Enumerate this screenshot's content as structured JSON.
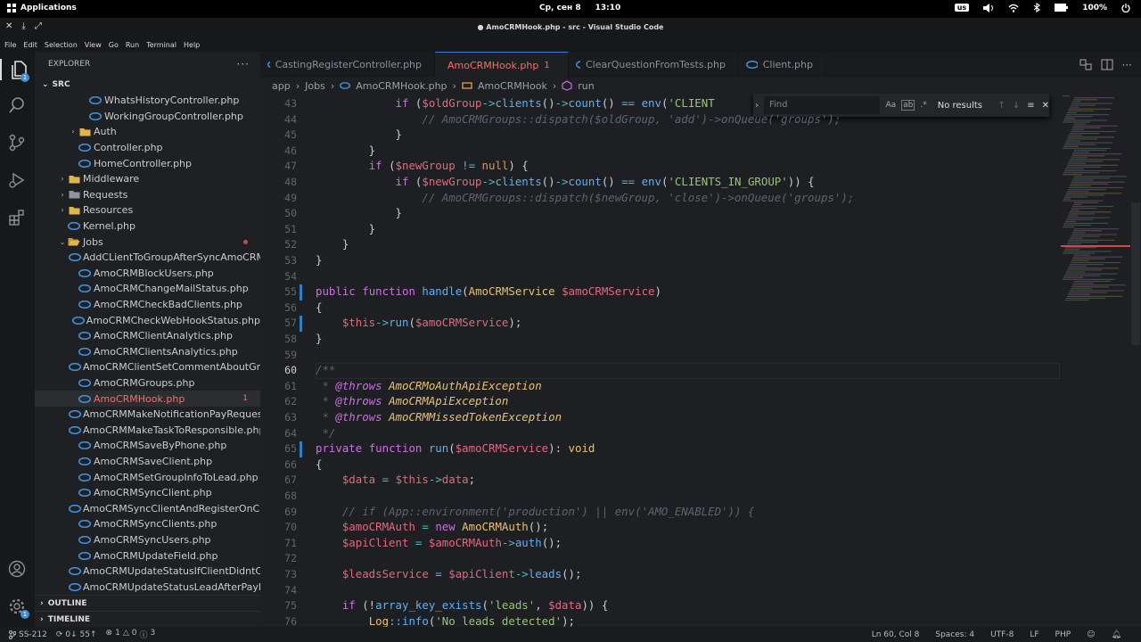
{
  "system_bar": {
    "apps_label": "Applications",
    "date": "Ср, сен  8",
    "time": "13:10",
    "keyboard_layout": "us",
    "battery": "100%"
  },
  "window": {
    "title": "● AmoCRMHook.php - src - Visual Studio Code"
  },
  "menu": [
    "File",
    "Edit",
    "Selection",
    "View",
    "Go",
    "Run",
    "Terminal",
    "Help"
  ],
  "activity_bar": {
    "explorer_badge": "1",
    "settings_badge": "1"
  },
  "sidebar": {
    "title": "EXPLORER",
    "section": "SRC",
    "rows": [
      {
        "label": "WhatsHistoryController.php",
        "indent": 3,
        "type": "php"
      },
      {
        "label": "WorkingGroupController.php",
        "indent": 3,
        "type": "php"
      },
      {
        "label": "Auth",
        "indent": 2,
        "type": "folder"
      },
      {
        "label": "Controller.php",
        "indent": 2,
        "type": "php"
      },
      {
        "label": "HomeController.php",
        "indent": 2,
        "type": "php"
      },
      {
        "label": "Middleware",
        "indent": 1,
        "type": "folder"
      },
      {
        "label": "Requests",
        "indent": 1,
        "type": "folder-grey"
      },
      {
        "label": "Resources",
        "indent": 1,
        "type": "folder"
      },
      {
        "label": "Kernel.php",
        "indent": 1,
        "type": "php"
      },
      {
        "label": "Jobs",
        "indent": 1,
        "type": "folder-open",
        "modified_dot": true
      },
      {
        "label": "AddCLientToGroupAfterSyncAmoCRM...",
        "indent": 2,
        "type": "php"
      },
      {
        "label": "AmoCRMBlockUsers.php",
        "indent": 2,
        "type": "php"
      },
      {
        "label": "AmoCRMChangeMailStatus.php",
        "indent": 2,
        "type": "php"
      },
      {
        "label": "AmoCRMCheckBadClients.php",
        "indent": 2,
        "type": "php"
      },
      {
        "label": "AmoCRMCheckWebHookStatus.php",
        "indent": 2,
        "type": "php"
      },
      {
        "label": "AmoCRMClientAnalytics.php",
        "indent": 2,
        "type": "php"
      },
      {
        "label": "AmoCRMClientsAnalytics.php",
        "indent": 2,
        "type": "php"
      },
      {
        "label": "AmoCRMClientSetCommentAboutGro...",
        "indent": 2,
        "type": "php"
      },
      {
        "label": "AmoCRMGroups.php",
        "indent": 2,
        "type": "php"
      },
      {
        "label": "AmoCRMHook.php",
        "indent": 2,
        "type": "php",
        "selected": true,
        "count": "1"
      },
      {
        "label": "AmoCRMMakeNotificationPayRequest....",
        "indent": 2,
        "type": "php"
      },
      {
        "label": "AmoCRMMakeTaskToResponsible.php",
        "indent": 2,
        "type": "php"
      },
      {
        "label": "AmoCRMSaveByPhone.php",
        "indent": 2,
        "type": "php"
      },
      {
        "label": "AmoCRMSaveClient.php",
        "indent": 2,
        "type": "php"
      },
      {
        "label": "AmoCRMSetGroupInfoToLead.php",
        "indent": 2,
        "type": "php"
      },
      {
        "label": "AmoCRMSyncClient.php",
        "indent": 2,
        "type": "php"
      },
      {
        "label": "AmoCRMSyncClientAndRegisterOnCas...",
        "indent": 2,
        "type": "php"
      },
      {
        "label": "AmoCRMSyncClients.php",
        "indent": 2,
        "type": "php"
      },
      {
        "label": "AmoCRMSyncUsers.php",
        "indent": 2,
        "type": "php"
      },
      {
        "label": "AmoCRMUpdateField.php",
        "indent": 2,
        "type": "php"
      },
      {
        "label": "AmoCRMUpdateStatusIfClientDidntCo...",
        "indent": 2,
        "type": "php"
      },
      {
        "label": "AmoCRMUpdateStatusLeadAfterPayRe...",
        "indent": 2,
        "type": "php"
      }
    ],
    "outline": "OUTLINE",
    "timeline": "TIMELINE"
  },
  "tabs": [
    {
      "label": "CastingRegisterController.php",
      "active": false
    },
    {
      "label": "AmoCRMHook.php",
      "active": true,
      "count": "1",
      "modified": true
    },
    {
      "label": "ClearQuestionFromTests.php",
      "active": false
    },
    {
      "label": "Client.php",
      "active": false
    }
  ],
  "breadcrumb": [
    "app",
    "Jobs",
    "AmoCRMHook.php",
    "AmoCRMHook",
    "run"
  ],
  "find_widget": {
    "placeholder": "Find",
    "opt_case": "Aa",
    "opt_word": "ab",
    "opt_regex": ".*",
    "result": "No results"
  },
  "editor": {
    "current_line": 60,
    "lines": [
      {
        "n": 43,
        "tokens": [
          [
            "pl",
            "            "
          ],
          [
            "kw",
            "if"
          ],
          [
            "pl",
            " ("
          ],
          [
            "var",
            "$oldGroup"
          ],
          [
            "op",
            "->"
          ],
          [
            "fn",
            "clients"
          ],
          [
            "pl",
            "()"
          ],
          [
            "op",
            "->"
          ],
          [
            "fn",
            "count"
          ],
          [
            "pl",
            "() "
          ],
          [
            "op",
            "=="
          ],
          [
            "pl",
            " "
          ],
          [
            "fn",
            "env"
          ],
          [
            "pl",
            "("
          ],
          [
            "str",
            "'CLIENT"
          ]
        ]
      },
      {
        "n": 44,
        "tokens": [
          [
            "cm",
            "                // AmoCRMGroups::dispatch($oldGroup, 'add')->onQueue('groups');"
          ]
        ]
      },
      {
        "n": 45,
        "tokens": [
          [
            "pl",
            "            }"
          ]
        ]
      },
      {
        "n": 46,
        "tokens": [
          [
            "pl",
            "        }"
          ]
        ]
      },
      {
        "n": 47,
        "tokens": [
          [
            "pl",
            "        "
          ],
          [
            "kw",
            "if"
          ],
          [
            "pl",
            " ("
          ],
          [
            "var",
            "$newGroup"
          ],
          [
            "pl",
            " "
          ],
          [
            "op",
            "!="
          ],
          [
            "pl",
            " "
          ],
          [
            "num",
            "null"
          ],
          [
            "pl",
            ") {"
          ]
        ]
      },
      {
        "n": 48,
        "tokens": [
          [
            "pl",
            "            "
          ],
          [
            "kw",
            "if"
          ],
          [
            "pl",
            " ("
          ],
          [
            "var",
            "$newGroup"
          ],
          [
            "op",
            "->"
          ],
          [
            "fn",
            "clients"
          ],
          [
            "pl",
            "()"
          ],
          [
            "op",
            "->"
          ],
          [
            "fn",
            "count"
          ],
          [
            "pl",
            "() "
          ],
          [
            "op",
            "=="
          ],
          [
            "pl",
            " "
          ],
          [
            "fn",
            "env"
          ],
          [
            "pl",
            "("
          ],
          [
            "str",
            "'CLIENTS_IN_GROUP'"
          ],
          [
            "pl",
            ")) {"
          ]
        ]
      },
      {
        "n": 49,
        "tokens": [
          [
            "cm",
            "                // AmoCRMGroups::dispatch($newGroup, 'close')->onQueue('groups');"
          ]
        ]
      },
      {
        "n": 50,
        "tokens": [
          [
            "pl",
            "            }"
          ]
        ]
      },
      {
        "n": 51,
        "tokens": [
          [
            "pl",
            "        }"
          ]
        ]
      },
      {
        "n": 52,
        "tokens": [
          [
            "pl",
            "    }"
          ]
        ]
      },
      {
        "n": 53,
        "tokens": [
          [
            "pl",
            "}"
          ]
        ]
      },
      {
        "n": 54,
        "tokens": [
          [
            "pl",
            ""
          ]
        ]
      },
      {
        "n": 55,
        "tokens": [
          [
            "kw",
            "public"
          ],
          [
            "pl",
            " "
          ],
          [
            "kw",
            "function"
          ],
          [
            "pl",
            " "
          ],
          [
            "fn",
            "handle"
          ],
          [
            "pl",
            "("
          ],
          [
            "cls",
            "AmoCRMService"
          ],
          [
            "pl",
            " "
          ],
          [
            "var",
            "$amoCRMService"
          ],
          [
            "pl",
            ")"
          ]
        ]
      },
      {
        "n": 56,
        "tokens": [
          [
            "pl",
            "{"
          ]
        ]
      },
      {
        "n": 57,
        "tokens": [
          [
            "pl",
            "    "
          ],
          [
            "var",
            "$this"
          ],
          [
            "op",
            "->"
          ],
          [
            "fn",
            "run"
          ],
          [
            "pl",
            "("
          ],
          [
            "var",
            "$amoCRMService"
          ],
          [
            "pl",
            ");"
          ]
        ]
      },
      {
        "n": 58,
        "tokens": [
          [
            "pl",
            "}"
          ]
        ]
      },
      {
        "n": 59,
        "tokens": [
          [
            "pl",
            ""
          ]
        ]
      },
      {
        "n": 60,
        "tokens": [
          [
            "cm",
            "/**"
          ]
        ]
      },
      {
        "n": 61,
        "tokens": [
          [
            "cm",
            " * "
          ],
          [
            "cmt",
            "@throws"
          ],
          [
            "pl",
            " "
          ],
          [
            "cmt2",
            "AmoCRMoAuthApiException"
          ]
        ]
      },
      {
        "n": 62,
        "tokens": [
          [
            "cm",
            " * "
          ],
          [
            "cmt",
            "@throws"
          ],
          [
            "pl",
            " "
          ],
          [
            "cmt2",
            "AmoCRMApiException"
          ]
        ]
      },
      {
        "n": 63,
        "tokens": [
          [
            "cm",
            " * "
          ],
          [
            "cmt",
            "@throws"
          ],
          [
            "pl",
            " "
          ],
          [
            "cmt2",
            "AmoCRMMissedTokenException"
          ]
        ]
      },
      {
        "n": 64,
        "tokens": [
          [
            "cm",
            " */"
          ]
        ]
      },
      {
        "n": 65,
        "tokens": [
          [
            "kw",
            "private"
          ],
          [
            "pl",
            " "
          ],
          [
            "kw",
            "function"
          ],
          [
            "pl",
            " "
          ],
          [
            "fn",
            "run"
          ],
          [
            "pl",
            "("
          ],
          [
            "var",
            "$amoCRMService"
          ],
          [
            "pl",
            "): "
          ],
          [
            "cls",
            "void"
          ]
        ]
      },
      {
        "n": 66,
        "tokens": [
          [
            "pl",
            "{"
          ]
        ]
      },
      {
        "n": 67,
        "tokens": [
          [
            "pl",
            "    "
          ],
          [
            "var",
            "$data"
          ],
          [
            "pl",
            " "
          ],
          [
            "op",
            "="
          ],
          [
            "pl",
            " "
          ],
          [
            "var",
            "$this"
          ],
          [
            "op",
            "->"
          ],
          [
            "var",
            "data"
          ],
          [
            "pl",
            ";"
          ]
        ]
      },
      {
        "n": 68,
        "tokens": [
          [
            "pl",
            ""
          ]
        ]
      },
      {
        "n": 69,
        "tokens": [
          [
            "cm",
            "    // if (App::environment('production') || env('AMO_ENABLED')) {"
          ]
        ]
      },
      {
        "n": 70,
        "tokens": [
          [
            "pl",
            "    "
          ],
          [
            "var",
            "$amoCRMAuth"
          ],
          [
            "pl",
            " "
          ],
          [
            "op",
            "="
          ],
          [
            "pl",
            " "
          ],
          [
            "kw",
            "new"
          ],
          [
            "pl",
            " "
          ],
          [
            "cls",
            "AmoCRMAuth"
          ],
          [
            "pl",
            "();"
          ]
        ]
      },
      {
        "n": 71,
        "tokens": [
          [
            "pl",
            "    "
          ],
          [
            "var",
            "$apiClient"
          ],
          [
            "pl",
            " "
          ],
          [
            "op",
            "="
          ],
          [
            "pl",
            " "
          ],
          [
            "var",
            "$amoCRMAuth"
          ],
          [
            "op",
            "->"
          ],
          [
            "fn",
            "auth"
          ],
          [
            "pl",
            "();"
          ]
        ]
      },
      {
        "n": 72,
        "tokens": [
          [
            "pl",
            ""
          ]
        ]
      },
      {
        "n": 73,
        "tokens": [
          [
            "pl",
            "    "
          ],
          [
            "var",
            "$leadsService"
          ],
          [
            "pl",
            " "
          ],
          [
            "op",
            "="
          ],
          [
            "pl",
            " "
          ],
          [
            "var",
            "$apiClient"
          ],
          [
            "op",
            "->"
          ],
          [
            "fn",
            "leads"
          ],
          [
            "pl",
            "();"
          ]
        ]
      },
      {
        "n": 74,
        "tokens": [
          [
            "pl",
            ""
          ]
        ]
      },
      {
        "n": 75,
        "tokens": [
          [
            "pl",
            "    "
          ],
          [
            "kw",
            "if"
          ],
          [
            "pl",
            " (!"
          ],
          [
            "fn",
            "array_key_exists"
          ],
          [
            "pl",
            "("
          ],
          [
            "str",
            "'leads'"
          ],
          [
            "pl",
            ", "
          ],
          [
            "var",
            "$data"
          ],
          [
            "pl",
            ")) {"
          ]
        ]
      },
      {
        "n": 76,
        "tokens": [
          [
            "pl",
            "        "
          ],
          [
            "cls",
            "Log"
          ],
          [
            "op",
            "::"
          ],
          [
            "fn",
            "info"
          ],
          [
            "pl",
            "("
          ],
          [
            "str",
            "'No leads detected'"
          ],
          [
            "pl",
            ");"
          ]
        ]
      }
    ]
  },
  "status_bar": {
    "branch": "SS-212",
    "sync": "0↓ 55↑",
    "errors": "1",
    "warnings": "0",
    "info": "3",
    "position": "Ln 60, Col 8",
    "spaces": "Spaces: 4",
    "encoding": "UTF-8",
    "eol": "LF",
    "language": "PHP"
  },
  "colors": {
    "accent": "#3b7dd8",
    "error": "#f0716a",
    "php_icon": "#3e8fd6",
    "folder": "#e0b64a"
  }
}
